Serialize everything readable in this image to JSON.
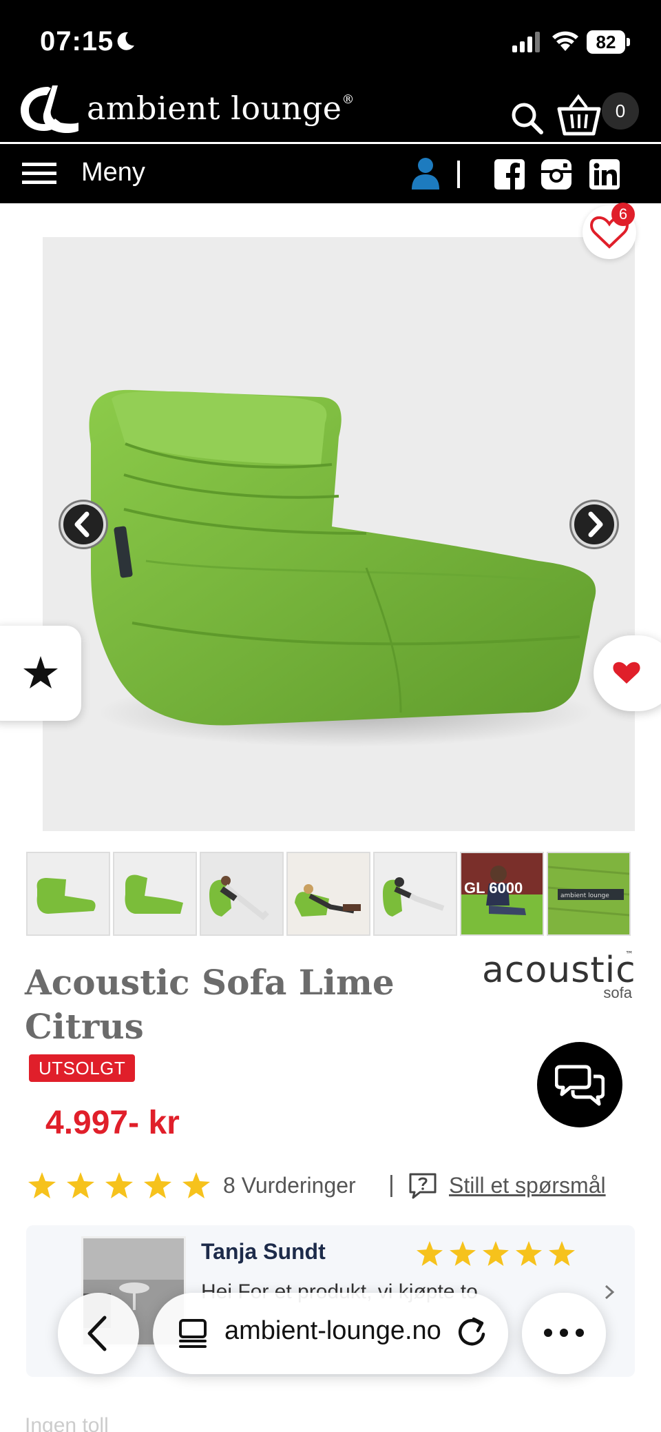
{
  "status_bar": {
    "time": "07:15",
    "battery": "82"
  },
  "header": {
    "brand": "ambient lounge",
    "brand_mark": "®",
    "cart_count": "0",
    "wishlist_count": "6"
  },
  "nav": {
    "menu_label": "Meny"
  },
  "gallery": {
    "main_image": "green bean bag sofa",
    "thumbnail_overlay": "GL 6000",
    "thumbnail_label_text": "ambient lounge"
  },
  "product": {
    "title": "Acoustic Sofa Lime Citrus",
    "brand_logo_text": "acoustic",
    "brand_logo_sub": "sofa",
    "brand_logo_tm": "™",
    "badge": "UTSOLGT",
    "price": "4.997- kr"
  },
  "rating": {
    "stars": 5,
    "count_label": "8 Vurderinger",
    "separator": "|",
    "ask_label": "Still et spørsmål"
  },
  "review": {
    "name": "Tanja Sundt",
    "stars": 5,
    "text": "Hei For et produkt, vi kjøpte to"
  },
  "browser": {
    "url": "ambient-lounge.no"
  },
  "footer_hint": "Ingen toll",
  "colors": {
    "accent_red": "#e01f2a",
    "star_yellow": "#f6c21c",
    "lime_green": "#7fbf3c",
    "header_black": "#000000"
  }
}
